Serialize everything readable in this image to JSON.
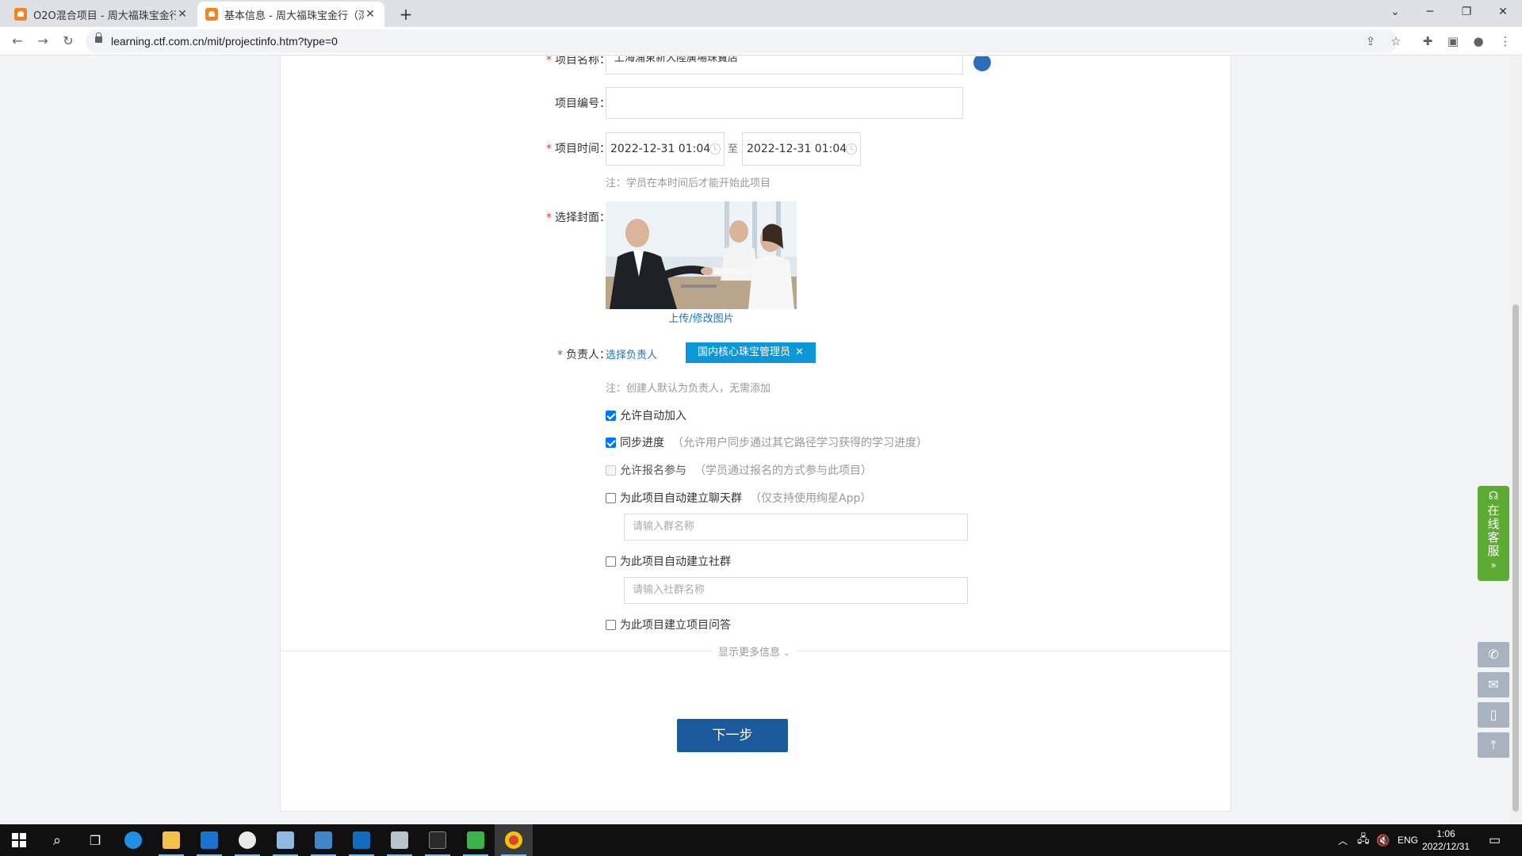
{
  "browser": {
    "tabs": [
      {
        "title": "O2O混合项目 - 周大福珠宝金行",
        "active": false
      },
      {
        "title": "基本信息 - 周大福珠宝金行（深",
        "active": true
      }
    ],
    "url": "learning.ctf.com.cn/mit/projectinfo.htm?type=0"
  },
  "form": {
    "project_name": {
      "label": "项目名称：",
      "value": "上海浦東新大陸廣場珠寶店"
    },
    "project_code": {
      "label": "项目编号：",
      "value": ""
    },
    "project_time": {
      "label": "项目时间：",
      "start": "2022-12-31 01:04",
      "separator": "至",
      "end": "2022-12-31 01:04",
      "note": "注：学员在本时间后才能开始此项目"
    },
    "cover": {
      "label": "选择封面：",
      "upload_link": "上传/修改图片"
    },
    "owner": {
      "label": "负责人：",
      "select_link": "选择负责人",
      "tag": "国内核心珠宝管理员",
      "note": "注：创建人默认为负责人，无需添加"
    },
    "options": [
      {
        "label": "允许自动加入",
        "hint": "",
        "checked": true,
        "disabled": false
      },
      {
        "label": "同步进度",
        "hint": "（允许用户同步通过其它路径学习获得的学习进度）",
        "checked": true,
        "disabled": false
      },
      {
        "label": "允许报名参与",
        "hint": "（学员通过报名的方式参与此项目）",
        "checked": false,
        "disabled": true
      },
      {
        "label": "为此项目自动建立聊天群",
        "hint": "（仅支持使用绚星App）",
        "checked": false,
        "disabled": false
      },
      {
        "label": "为此项目自动建立社群",
        "hint": "",
        "checked": false,
        "disabled": false
      },
      {
        "label": "为此项目建立项目问答",
        "hint": "",
        "checked": false,
        "disabled": false
      }
    ],
    "chat_group_placeholder": "请输入群名称",
    "community_placeholder": "请输入社群名称",
    "more_info": "显示更多信息",
    "next_button": "下一步"
  },
  "service": {
    "label": "在线客服"
  },
  "taskbar": {
    "lang": "ENG",
    "time": "1:06",
    "date": "2022/12/31"
  },
  "colors": {
    "primary_button": "#1c5a9e",
    "tag_bg": "#0c98d8",
    "link": "#1a73c8",
    "service_green": "#5cab33",
    "required": "#e4393c"
  }
}
